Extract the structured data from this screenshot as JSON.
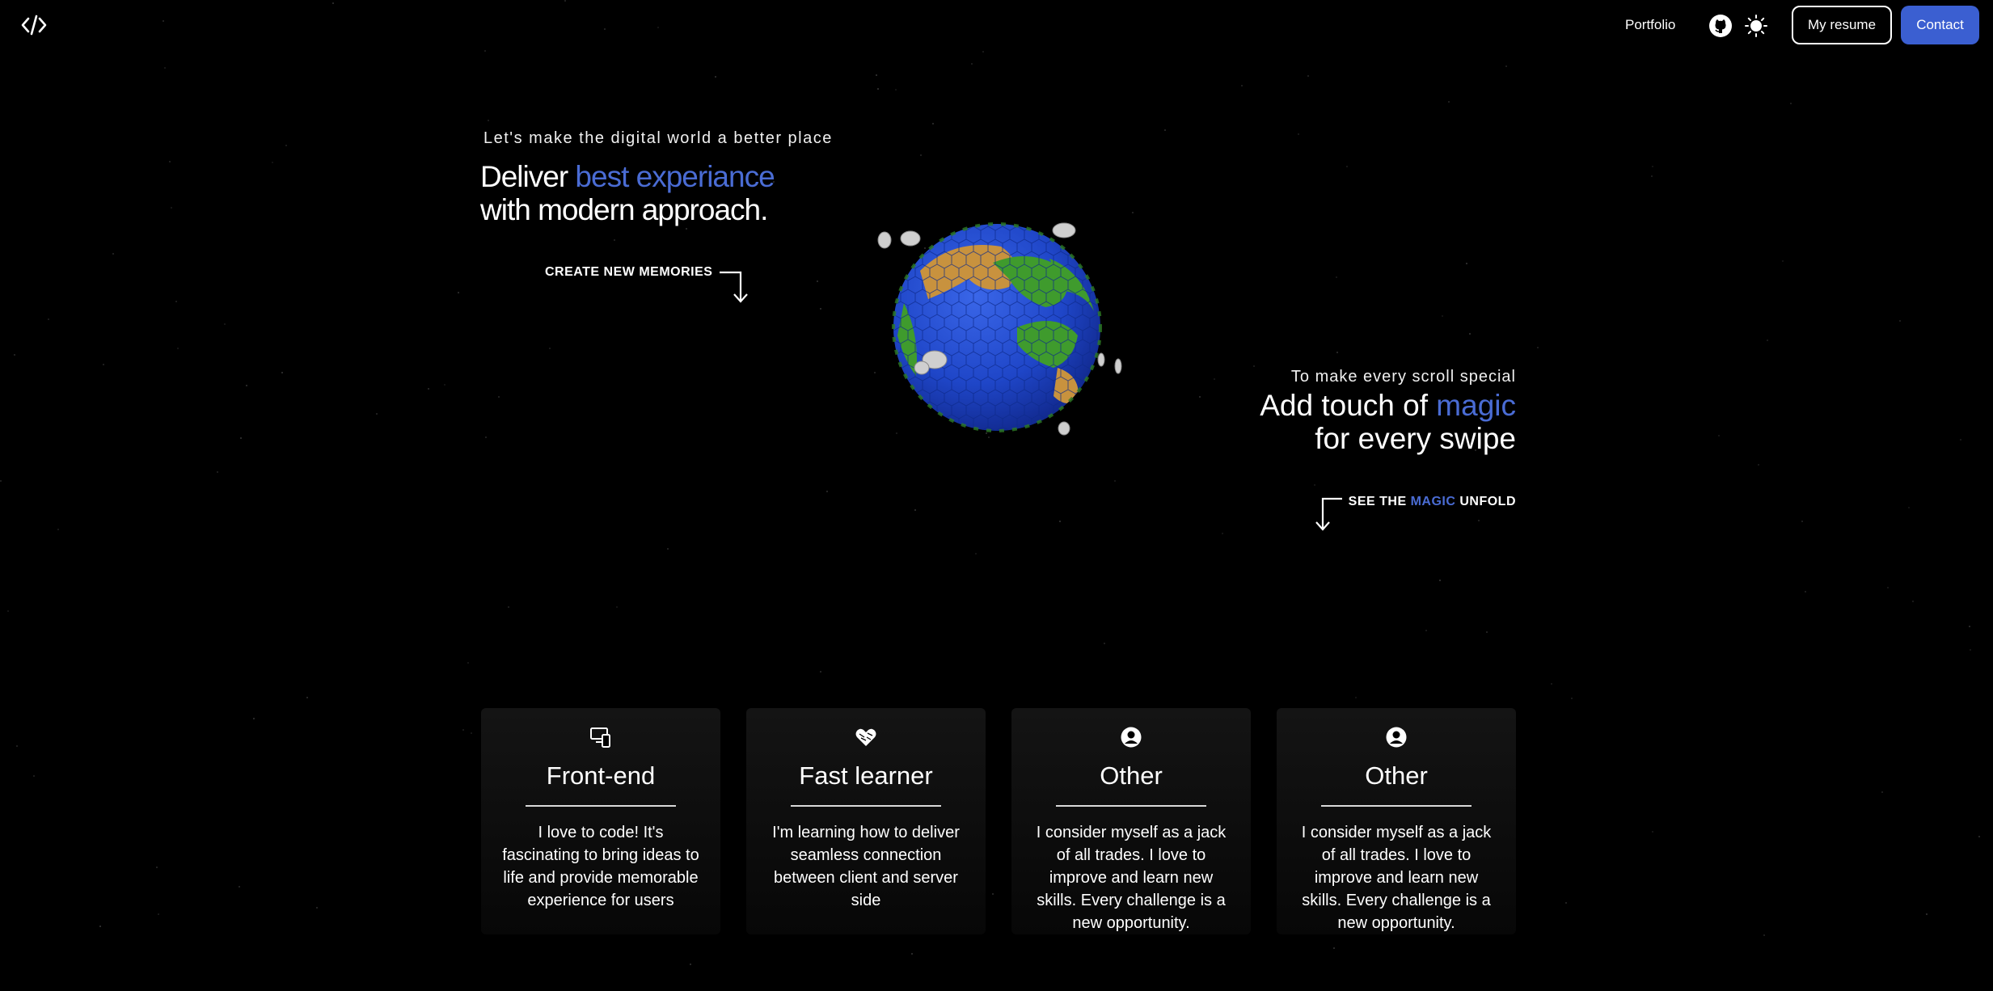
{
  "nav": {
    "logo_icon": "code-brackets-icon",
    "portfolio_label": "Portfolio",
    "github_icon": "github-icon",
    "theme_icon": "sun-icon",
    "resume_label": "My resume",
    "contact_label": "Contact"
  },
  "hero_left": {
    "tagline": "Let's make the digital world a better place",
    "headline_plain_1": "Deliver ",
    "headline_accent": "best experiance",
    "headline_line_2": "with modern approach.",
    "cta": "CREATE NEW MEMORIES"
  },
  "hero_right": {
    "tagline": "To make every scroll special",
    "headline_plain_1": "Add touch of ",
    "headline_accent": "magic",
    "headline_line_2": "for every swipe",
    "cta_part_1": "SEE THE ",
    "cta_accent": "MAGIC",
    "cta_part_2": " UNFOLD"
  },
  "cards": [
    {
      "icon": "devices-icon",
      "title": "Front-end",
      "text": "I love to code! It's fascinating to bring ideas to life and provide memorable experience for users"
    },
    {
      "icon": "heart-icon",
      "title": "Fast learner",
      "text": "I'm learning how to deliver seamless connection between client and server side"
    },
    {
      "icon": "user-circle-icon",
      "title": "Other",
      "text": "I consider myself as a jack of all trades. I love to improve and learn new skills. Every challenge is a new opportunity."
    },
    {
      "icon": "user-circle-icon",
      "title": "Other",
      "text": "I consider myself as a jack of all trades. I love to improve and learn new skills. Every challenge is a new opportunity."
    }
  ],
  "colors": {
    "background": "#000000",
    "accent": "#4a6cd4",
    "primary_button": "#3b5fd1",
    "text": "#ffffff"
  }
}
